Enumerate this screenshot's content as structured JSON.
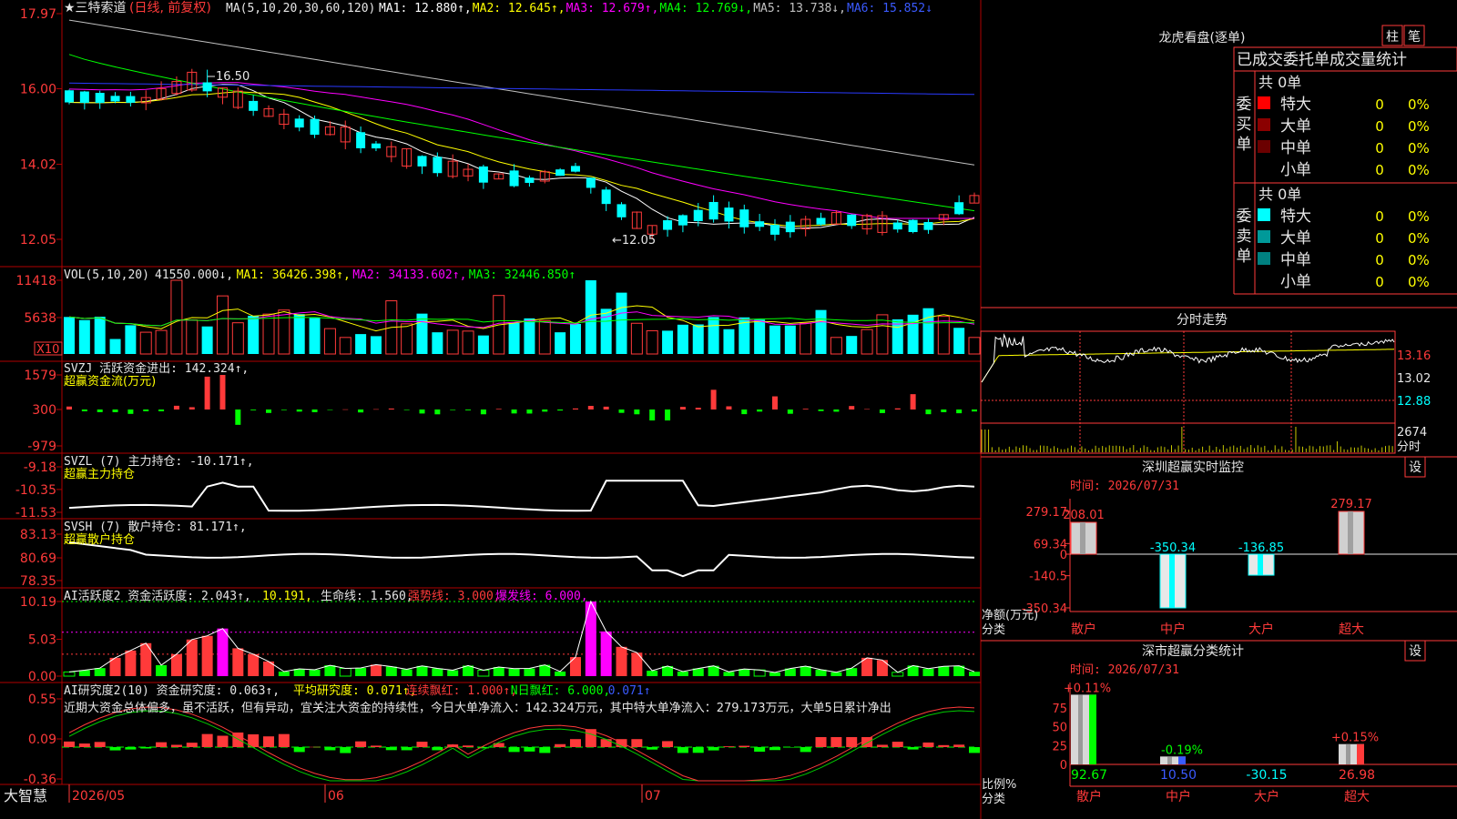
{
  "app": {
    "brand": "大智慧"
  },
  "main": {
    "stock_label": "★三特索道",
    "stock_mode": "(日线, 前复权)",
    "ma_label": "MA(5,10,20,30,60,120)",
    "ma_items": [
      {
        "text": "MA1: 12.880↑,",
        "color": "#ffffff"
      },
      {
        "text": "MA2: 12.645↑,",
        "color": "#ffff00"
      },
      {
        "text": "MA3: 12.679↑,",
        "color": "#ff00ff"
      },
      {
        "text": "MA4: 12.769↓,",
        "color": "#00ff00"
      },
      {
        "text": "MA5: 13.738↓,",
        "color": "#c0c0c0"
      },
      {
        "text": "MA6: 15.852↓",
        "color": "#3a5aff"
      }
    ],
    "y_ticks": [
      "17.97",
      "16.00",
      "14.02",
      "12.05"
    ],
    "annot_high": "16.50",
    "annot_low": "←12.05"
  },
  "vol": {
    "label": "VOL(5,10,20)",
    "items": [
      {
        "text": "41550.000↓,",
        "color": "#e6e6e6"
      },
      {
        "text": "MA1: 36426.398↑,",
        "color": "#ffff00"
      },
      {
        "text": "MA2: 34133.602↑,",
        "color": "#ff00ff"
      },
      {
        "text": "MA3: 32446.850↑",
        "color": "#00ff00"
      }
    ],
    "y_ticks": [
      "11418",
      "5638"
    ],
    "unit": "X10"
  },
  "svzj": {
    "label": "SVZJ  活跃资金进出: 142.324↑,",
    "sub": "超赢资金流(万元)",
    "y_ticks": [
      "1579",
      "300",
      "-979"
    ]
  },
  "svzl": {
    "label": "SVZL (7) 主力持仓: -10.171↑,",
    "sub": "超赢主力持仓",
    "y_ticks": [
      "-9.18",
      "-10.35",
      "-11.53"
    ]
  },
  "svsh": {
    "label": "SVSH (7) 散户持仓: 81.171↑,",
    "sub": "超赢散户持仓",
    "y_ticks": [
      "83.13",
      "80.69",
      "78.35"
    ]
  },
  "ai1": {
    "label": "AI活跃度2 资金活跃度: 2.043↑,",
    "items": [
      {
        "text": "10.191,",
        "color": "#ffff00"
      },
      {
        "text": "生命线: 1.560,",
        "color": "#e6e6e6"
      },
      {
        "text": "强势线: 3.000,",
        "color": "#ff3a3a"
      },
      {
        "text": "爆发线: 6.000,",
        "color": "#ff00ff"
      }
    ],
    "y_ticks": [
      "10.19",
      "5.03",
      "0.00"
    ]
  },
  "ai2": {
    "label": "AI研究度2(10) 资金研究度: 0.063↑,",
    "items": [
      {
        "text": "平均研究度: 0.071↑,",
        "color": "#ffff00"
      },
      {
        "text": "连续飘红: 1.000↑,",
        "color": "#ff3a3a"
      },
      {
        "text": "N日飘红: 6.000,",
        "color": "#00ff00"
      },
      {
        "text": "0.071↑",
        "color": "#3a5aff"
      }
    ],
    "comment": "近期大资金总体偏多，虽不活跃，但有异动，宜关注大资金的持续性，今日大单净流入：142.324万元，其中特大单净流入：279.173万元，大单5日累计净出",
    "y_ticks": [
      "0.55",
      "0.09",
      "-0.36"
    ]
  },
  "xaxis": {
    "labels": [
      "2026/05",
      "06",
      "07"
    ]
  },
  "right": {
    "lhb_title": "龙虎看盘(逐单)",
    "btn_zhu": "柱",
    "btn_bi": "笔",
    "stats_title": "已成交委托单成交量统计",
    "buy_group": "委买单",
    "sell_group": "委卖单",
    "buy_total": "共 0单",
    "sell_total": "共 0单",
    "buy_rows": [
      {
        "name": "特大",
        "count": "0",
        "pct": "0%",
        "color": "#ff0000"
      },
      {
        "name": "大单",
        "count": "0",
        "pct": "0%",
        "color": "#8b0000"
      },
      {
        "name": "中单",
        "count": "0",
        "pct": "0%",
        "color": "#6b0000"
      },
      {
        "name": "小单",
        "count": "0",
        "pct": "0%",
        "color": ""
      }
    ],
    "sell_rows": [
      {
        "name": "特大",
        "count": "0",
        "pct": "0%",
        "color": "#00ffff"
      },
      {
        "name": "大单",
        "count": "0",
        "pct": "0%",
        "color": "#009999"
      },
      {
        "name": "中单",
        "count": "0",
        "pct": "0%",
        "color": "#008080"
      },
      {
        "name": "小单",
        "count": "0",
        "pct": "0%",
        "color": ""
      }
    ],
    "intraday_title": "分时走势",
    "intraday_ticks": [
      "13.16",
      "13.02",
      "12.88",
      "2674",
      "分时"
    ],
    "monitor_title": "深圳超赢实时监控",
    "monitor_btn": "设",
    "monitor_time": "时间: 2026/07/31",
    "monitor_ticks": [
      "279.17",
      "69.34",
      "0",
      "-140.5",
      "-350.34"
    ],
    "monitor_axis1": "净额(万元)",
    "monitor_axis2": "分类",
    "monitor_bars": [
      {
        "cat": "散户",
        "value": 208.01,
        "label": "208.01"
      },
      {
        "cat": "中户",
        "value": -350.34,
        "label": "-350.34"
      },
      {
        "cat": "大户",
        "value": -136.85,
        "label": "-136.85"
      },
      {
        "cat": "超大",
        "value": 279.17,
        "label": "279.17"
      }
    ],
    "class_title": "深市超赢分类统计",
    "class_btn": "设",
    "class_time": "时间: 2026/07/31",
    "class_ticks": [
      "75",
      "50",
      "25",
      "0"
    ],
    "class_axis1": "比例%",
    "class_axis2": "分类",
    "class_bars": [
      {
        "cat": "散户",
        "value": 92.67,
        "label": "92.67",
        "top": "+0.11%"
      },
      {
        "cat": "中户",
        "value": 10.5,
        "label": "10.50",
        "top": "-0.19%"
      },
      {
        "cat": "大户",
        "value": -30.15,
        "label": "-30.15",
        "top": ""
      },
      {
        "cat": "超大",
        "value": 26.98,
        "label": "26.98",
        "top": "+0.15%"
      }
    ]
  },
  "colors": {
    "up": "#ff3a3a",
    "down": "#00ffff",
    "grid": "#b00000"
  }
}
